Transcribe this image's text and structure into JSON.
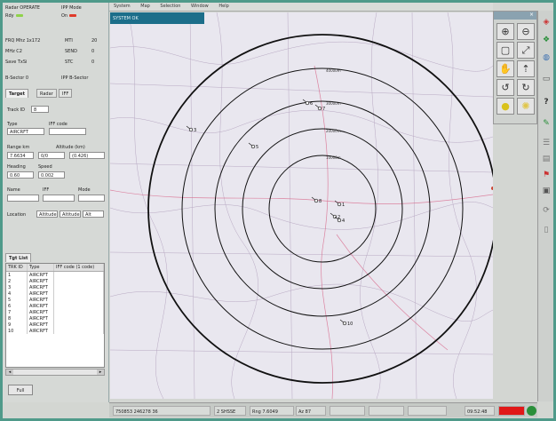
{
  "menu": [
    "System",
    "Map",
    "Selection",
    "Window",
    "Help"
  ],
  "window_title": "SYSTEM OK",
  "status_panel": {
    "radar_status": "Radar OPERATE",
    "rdy": "Rdy",
    "ipp_mode": "IPP Mode",
    "ipp_value": "On",
    "row2": [
      {
        "label": "FRQ Mhz 1x172",
        "sub": "MTI",
        "value": "20"
      },
      {
        "label": "MHz  C2",
        "sub": "SEND",
        "value": "0"
      },
      {
        "label": "Save  TxSi",
        "sub": "STC",
        "value": "0"
      }
    ],
    "b_sector": "B-Sector  0",
    "ipp_sector": "IPP B-Sector"
  },
  "tabs": [
    "Target",
    "Radar",
    "IFF"
  ],
  "target": {
    "track_id_label": "Track ID",
    "track_id_value": "8",
    "type_label": "Type",
    "type_value": "AIRCRFT",
    "iff_label": "IFF code",
    "iff_value": "",
    "range_label": "Range km",
    "altitude_label": "Altitude (km)",
    "range_value": "7.6634",
    "alt_mid": "0/0",
    "alt_value": "(0.426)",
    "heading_label": "Heading",
    "speed_label": "Speed",
    "heading_value": "0.60",
    "speed_value": "0.002",
    "name_label": "Name",
    "iff2_label": "IFF",
    "mode_label": "Mode",
    "location_label": "Location",
    "location_a": "Altitude",
    "location_b": "Altitude",
    "location_c": "Alt"
  },
  "tgt_list": {
    "tab": "Tgt List",
    "headers": [
      "TRK ID",
      "Type",
      "IFF code (1 code)"
    ],
    "rows": [
      {
        "id": "1",
        "type": "AIRCRFT",
        "iff": ""
      },
      {
        "id": "2",
        "type": "AIRCRFT",
        "iff": ""
      },
      {
        "id": "3",
        "type": "AIRCRFT",
        "iff": ""
      },
      {
        "id": "4",
        "type": "AIRCRFT",
        "iff": ""
      },
      {
        "id": "5",
        "type": "AIRCRFT",
        "iff": ""
      },
      {
        "id": "6",
        "type": "AIRCRFT",
        "iff": ""
      },
      {
        "id": "7",
        "type": "AIRCRFT",
        "iff": ""
      },
      {
        "id": "8",
        "type": "AIRCRFT",
        "iff": ""
      },
      {
        "id": "9",
        "type": "AIRCRFT",
        "iff": ""
      },
      {
        "id": "10",
        "type": "AIRCRFT",
        "iff": ""
      }
    ],
    "button": "Full"
  },
  "range_labels": [
    "10000m",
    "20000m",
    "30000m",
    "40000m"
  ],
  "targets": [
    {
      "id": "T1",
      "label": "6"
    },
    {
      "id": "T2",
      "label": "7"
    },
    {
      "id": "T3",
      "label": "3"
    },
    {
      "id": "T4",
      "label": "5"
    },
    {
      "id": "T5",
      "label": "8"
    },
    {
      "id": "T6",
      "label": "1"
    },
    {
      "id": "T7",
      "label": "2"
    },
    {
      "id": "T8",
      "label": "4"
    },
    {
      "id": "T9",
      "label": "10"
    }
  ],
  "statusbar": {
    "coords": "750853  246278  36",
    "mode": "2 SHSSE",
    "range": "Rng 7.6049",
    "az": "Az 87",
    "time": "09:52:48"
  },
  "colors": {
    "accent": "#1c6e8a",
    "frame": "#4f9a8a",
    "alarm": "#e01818",
    "ok": "#2a8f3a"
  }
}
